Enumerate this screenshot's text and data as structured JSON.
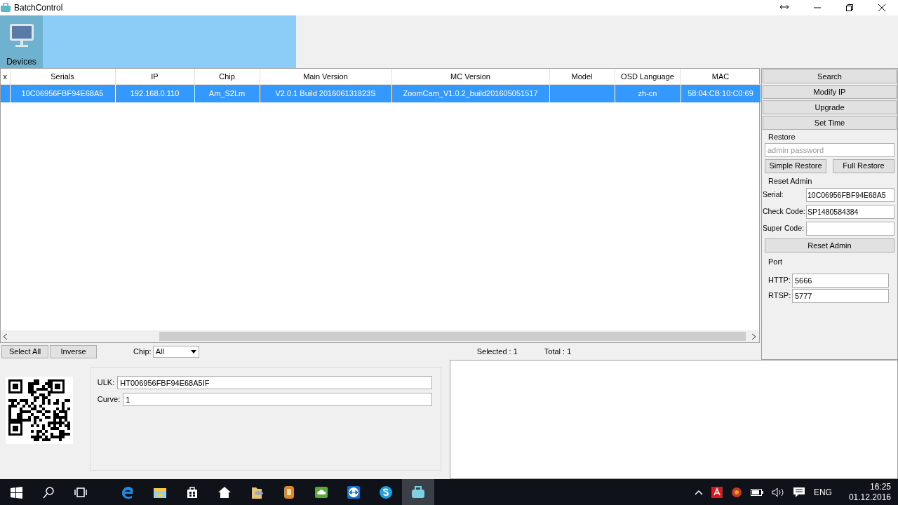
{
  "window": {
    "title": "BatchControl"
  },
  "ribbon": {
    "tabs": [
      {
        "label": "Devices",
        "selected": true
      }
    ]
  },
  "table": {
    "columns": [
      "x",
      "Serials",
      "IP",
      "Chip",
      "Main Version",
      "MC Version",
      "Model",
      "OSD Language",
      "MAC"
    ],
    "rows": [
      {
        "selected": true,
        "cells": [
          "",
          "10C06956FBF94E68A5",
          "192.168.0.110",
          "Am_S2Lm",
          "V2.0.1 Build 201606131823S",
          "ZoomCam_V1.0.2_build201605051517",
          "",
          "zh-cn",
          "58:04:CB:10:C0:69"
        ]
      }
    ]
  },
  "side_panel": {
    "buttons": [
      "Search",
      "Modify IP",
      "Upgrade",
      "Set Time"
    ],
    "restore": {
      "title": "Restore",
      "password": {
        "placeholder": "admin password"
      },
      "buttons": [
        "Simple Restore",
        "Full Restore"
      ]
    },
    "reset_admin": {
      "title": "Reset Admin",
      "fields": [
        {
          "label": "Serial:",
          "value": "10C06956FBF94E68A5"
        },
        {
          "label": "Check Code:",
          "value": "SP1480584384"
        },
        {
          "label": "Super Code:"
        }
      ],
      "button": "Reset Admin"
    },
    "port": {
      "title": "Port",
      "fields": [
        {
          "label": "HTTP:",
          "value": "5666"
        },
        {
          "label": "RTSP:",
          "value": "5777"
        }
      ]
    }
  },
  "toolbar": {
    "buttons": [
      "Select All",
      "Inverse"
    ],
    "chip_filter": {
      "label": "Chip:",
      "value": "All"
    },
    "selected": "Selected : 1",
    "total": "Total : 1"
  },
  "details": {
    "fields": [
      {
        "label": "ULK:",
        "value": "HT006956FBF94E68A5IF"
      },
      {
        "label": "Curve:",
        "value": "1"
      }
    ]
  },
  "taskbar": {
    "apps": [
      {
        "kind": "start",
        "selected": false
      },
      {
        "kind": "search",
        "selected": false
      },
      {
        "kind": "taskview",
        "selected": false
      },
      {
        "kind": "edge",
        "selected": false
      },
      {
        "kind": "explorer",
        "selected": false
      },
      {
        "kind": "store",
        "selected": false
      },
      {
        "kind": "home",
        "selected": false
      },
      {
        "kind": "folder",
        "selected": false
      },
      {
        "kind": "notes",
        "selected": false
      },
      {
        "kind": "cloud",
        "selected": false
      },
      {
        "kind": "remote",
        "selected": false
      },
      {
        "kind": "skype",
        "selected": false
      },
      {
        "kind": "case",
        "selected": true
      }
    ],
    "language": "ENG",
    "time": "16:25",
    "date": "01.12.2016"
  }
}
